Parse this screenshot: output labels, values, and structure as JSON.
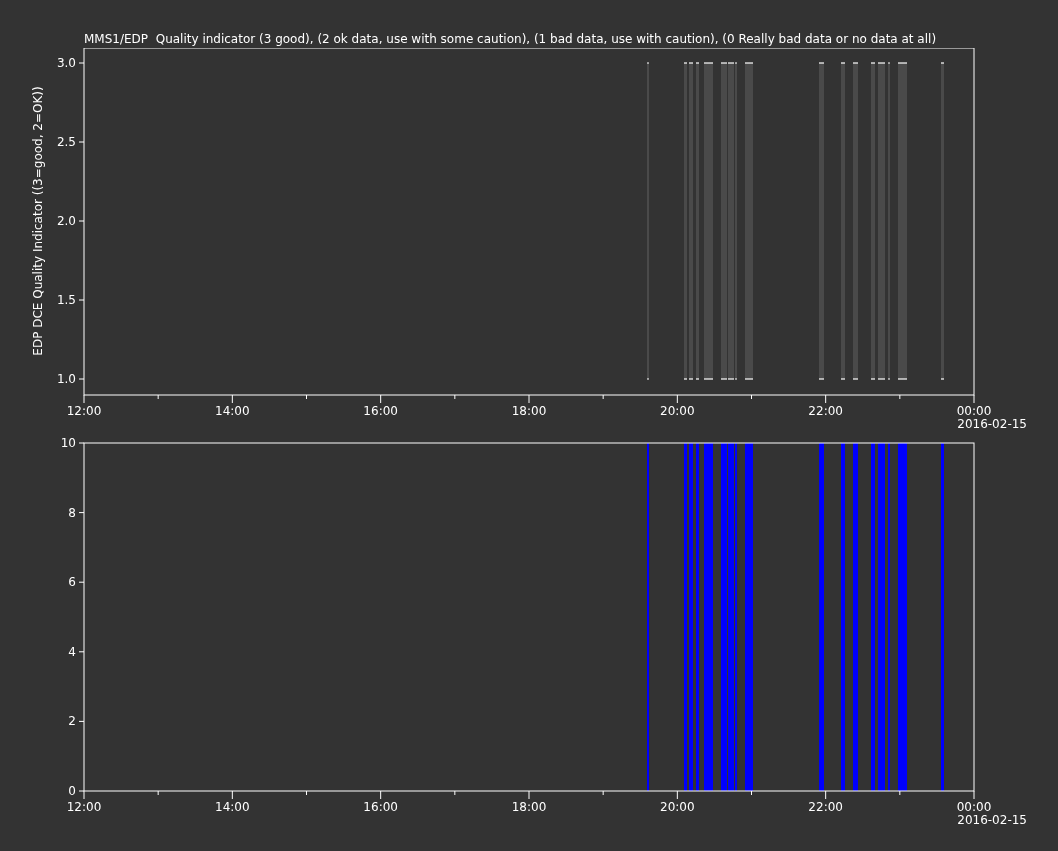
{
  "title": "MMS1/EDP  Quality indicator (3 good), (2 ok data, use with some caution), (1 bad data, use with caution), (0 Really bad data or no data at all)",
  "panels": [
    {
      "kind": "quality",
      "ylabel": "EDP DCE Quality Indicator ((3=good, 2=OK))",
      "yticks": [
        "3.0",
        "2.5",
        "2.0",
        "1.5",
        "1.0"
      ],
      "xticks": [
        "12:00",
        "14:00",
        "16:00",
        "18:00",
        "20:00",
        "22:00",
        "00:00"
      ],
      "date": "2016-02-15"
    },
    {
      "kind": "count",
      "yticks": [
        "10",
        "8",
        "6",
        "4",
        "2",
        "0"
      ],
      "xticks": [
        "12:00",
        "14:00",
        "16:00",
        "18:00",
        "20:00",
        "22:00",
        "00:00"
      ],
      "date": "2016-02-15"
    }
  ]
}
